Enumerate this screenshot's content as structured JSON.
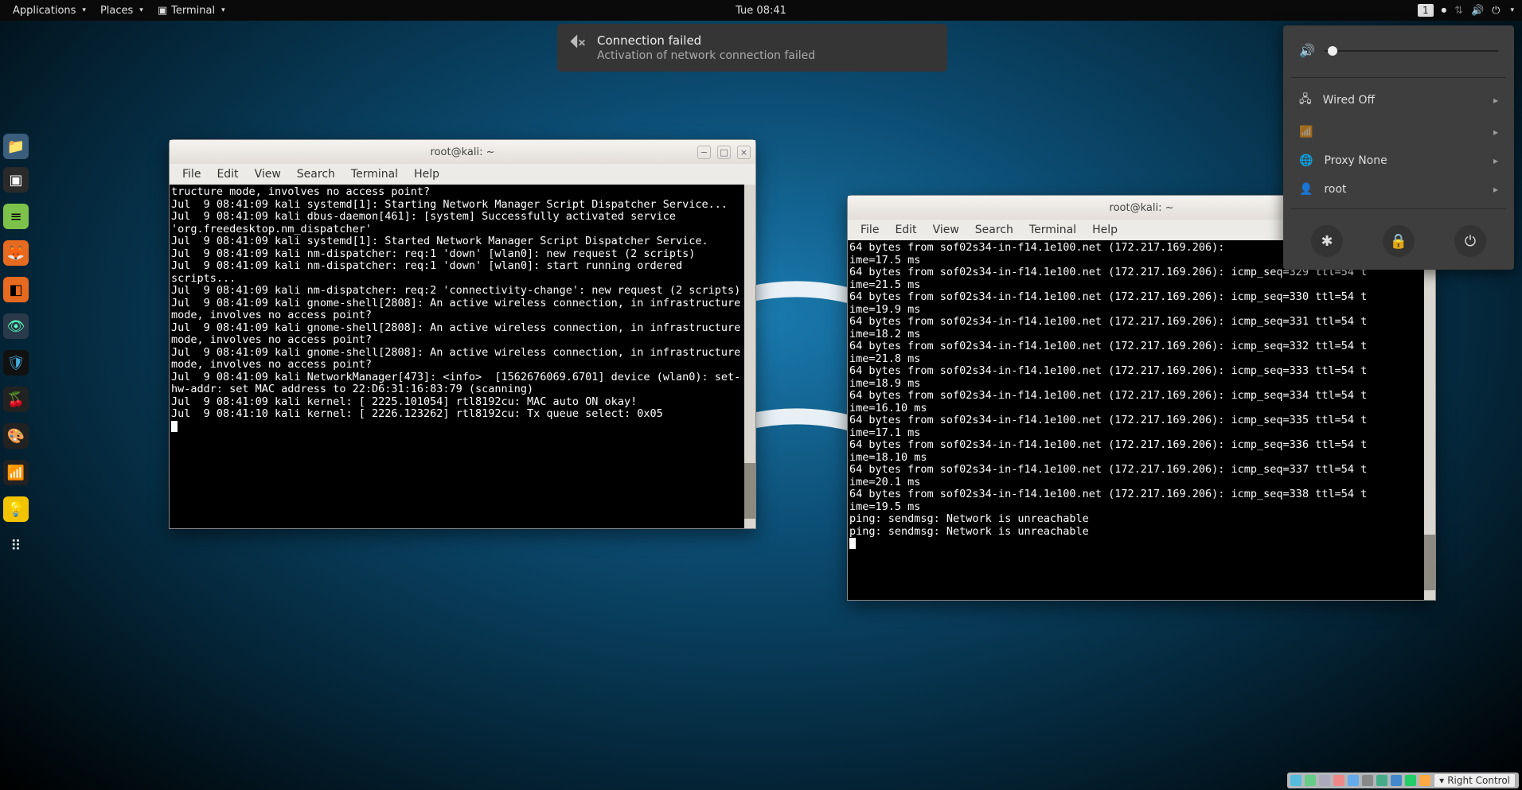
{
  "topbar": {
    "applications": "Applications",
    "places": "Places",
    "terminal": "Terminal",
    "clock": "Tue 08:41",
    "keyboard": "1"
  },
  "notification": {
    "title": "Connection failed",
    "message": "Activation of network connection failed"
  },
  "syspop": {
    "wired": "Wired Off",
    "proxy": "Proxy None",
    "user": "root"
  },
  "terminal_menu": {
    "file": "File",
    "edit": "Edit",
    "view": "View",
    "search": "Search",
    "terminal": "Terminal",
    "help": "Help"
  },
  "term1": {
    "title": "root@kali: ~",
    "content": "tructure mode, involves no access point?\nJul  9 08:41:09 kali systemd[1]: Starting Network Manager Script Dispatcher Service...\nJul  9 08:41:09 kali dbus-daemon[461]: [system] Successfully activated service 'org.freedesktop.nm_dispatcher'\nJul  9 08:41:09 kali systemd[1]: Started Network Manager Script Dispatcher Service.\nJul  9 08:41:09 kali nm-dispatcher: req:1 'down' [wlan0]: new request (2 scripts)\nJul  9 08:41:09 kali nm-dispatcher: req:1 'down' [wlan0]: start running ordered scripts...\nJul  9 08:41:09 kali nm-dispatcher: req:2 'connectivity-change': new request (2 scripts)\nJul  9 08:41:09 kali gnome-shell[2808]: An active wireless connection, in infrastructure mode, involves no access point?\nJul  9 08:41:09 kali gnome-shell[2808]: An active wireless connection, in infrastructure mode, involves no access point?\nJul  9 08:41:09 kali gnome-shell[2808]: An active wireless connection, in infrastructure mode, involves no access point?\nJul  9 08:41:09 kali NetworkManager[473]: <info>  [1562676069.6701] device (wlan0): set-hw-addr: set MAC address to 22:D6:31:16:83:79 (scanning)\nJul  9 08:41:09 kali kernel: [ 2225.101054] rtl8192cu: MAC auto ON okay!\nJul  9 08:41:10 kali kernel: [ 2226.123262] rtl8192cu: Tx queue select: 0x05"
  },
  "term2": {
    "title": "root@kali: ~",
    "content": "64 bytes from sof02s34-in-f14.1e100.net (172.217.169.206): \nime=17.5 ms\n64 bytes from sof02s34-in-f14.1e100.net (172.217.169.206): icmp_seq=329 ttl=54 t\nime=21.5 ms\n64 bytes from sof02s34-in-f14.1e100.net (172.217.169.206): icmp_seq=330 ttl=54 t\nime=19.9 ms\n64 bytes from sof02s34-in-f14.1e100.net (172.217.169.206): icmp_seq=331 ttl=54 t\nime=18.2 ms\n64 bytes from sof02s34-in-f14.1e100.net (172.217.169.206): icmp_seq=332 ttl=54 t\nime=21.8 ms\n64 bytes from sof02s34-in-f14.1e100.net (172.217.169.206): icmp_seq=333 ttl=54 t\nime=18.9 ms\n64 bytes from sof02s34-in-f14.1e100.net (172.217.169.206): icmp_seq=334 ttl=54 t\nime=16.10 ms\n64 bytes from sof02s34-in-f14.1e100.net (172.217.169.206): icmp_seq=335 ttl=54 t\nime=17.1 ms\n64 bytes from sof02s34-in-f14.1e100.net (172.217.169.206): icmp_seq=336 ttl=54 t\nime=18.10 ms\n64 bytes from sof02s34-in-f14.1e100.net (172.217.169.206): icmp_seq=337 ttl=54 t\nime=20.1 ms\n64 bytes from sof02s34-in-f14.1e100.net (172.217.169.206): icmp_seq=338 ttl=54 t\nime=19.5 ms\nping: sendmsg: Network is unreachable\nping: sendmsg: Network is unreachable"
  },
  "tray": {
    "label": "Right Control"
  }
}
